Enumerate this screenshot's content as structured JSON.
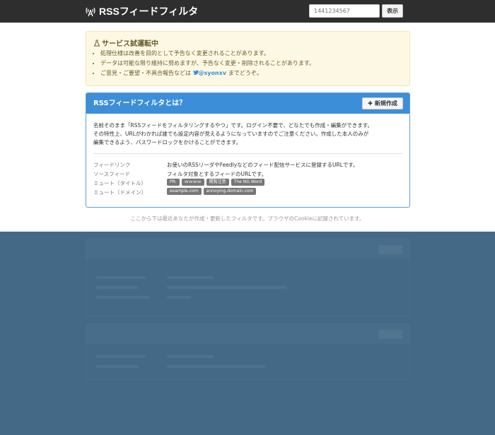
{
  "navbar": {
    "brand": "RSSフィードフィルタ",
    "icon": "antenna-icon",
    "search_placeholder": "1441234567",
    "show_button": "表示"
  },
  "alert": {
    "title": "サービス試運転中",
    "icon": "flask-icon",
    "items": [
      "処理仕様は改善を目的として予告なく変更されることがあります。",
      "データは可能な限り維持に努めますが、予告なく変更・削除されることがあります。"
    ],
    "contact_prefix": "ご意見・ご要望・不具合報告などは",
    "twitter_handle": "@syonxv",
    "contact_suffix": "までどうぞ。"
  },
  "panel": {
    "title": "RSSフィードフィルタとは？",
    "new_button": "新規作成",
    "header_color": "#3d8ed8",
    "description": [
      "名前そのまま「RSSフィードをフィルタリングするやつ」です。ログイン不要で、どなたでも作成・編集ができます。",
      "その特性上、URLがわかれば誰でも設定内容が見えるようになっていますのでご注意ください。作成した本人のみが",
      "編集できるよう、パスワードロックをかけることができます。"
    ],
    "fields": [
      {
        "label": "フィードリンク",
        "value": "お使いのRSSリーダやFeedlyなどのフィード配信サービスに登録するURLです。"
      },
      {
        "label": "ソースフィード",
        "value": "フィルタ対象とするフィードのURLです。"
      },
      {
        "label": "ミュート（タイトル）",
        "tags": [
          "PR:",
          "ｗｗｗｗ",
          "閲覧注意",
          "The NG Word"
        ]
      },
      {
        "label": "ミュート（ドメイン）",
        "tags": [
          "example.com",
          "annoying.domain.com"
        ]
      }
    ]
  },
  "note": "ここから下は最近あなたが作成・更新したフィルタです。ブラウザのCookieに記録されています。",
  "overlay_color": "#436987"
}
